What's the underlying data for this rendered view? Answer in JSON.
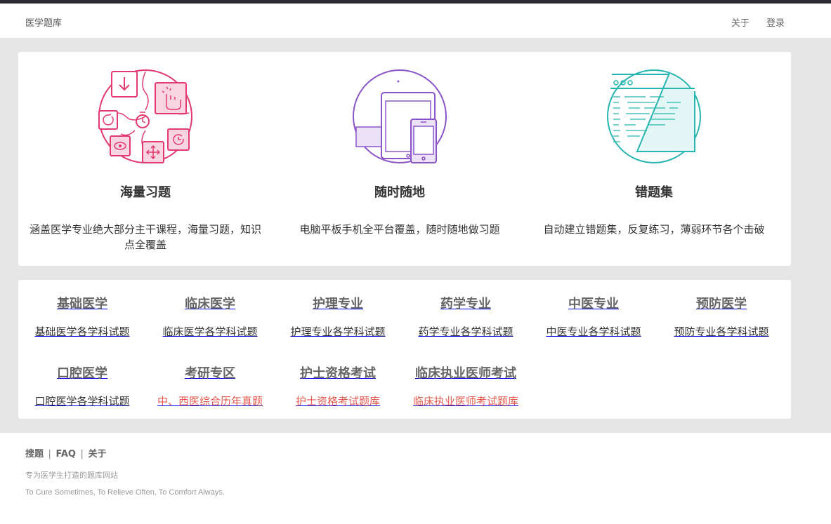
{
  "nav": {
    "brand": "医学题库",
    "links": [
      "关于",
      "登录"
    ]
  },
  "features": [
    {
      "icon": "practice-tools-icon",
      "title": "海量习题",
      "desc": "涵盖医学专业绝大部分主干课程，海量习题，知识点全覆盖"
    },
    {
      "icon": "devices-icon",
      "title": "随时随地",
      "desc": "电脑平板手机全平台覆盖，随时随地做习题"
    },
    {
      "icon": "notebook-icon",
      "title": "错题集",
      "desc": "自动建立错题集，反复练习，薄弱环节各个击破"
    }
  ],
  "subjects": [
    {
      "title": "基础医学",
      "desc": "基础医学各学科试题"
    },
    {
      "title": "临床医学",
      "desc": "临床医学各学科试题"
    },
    {
      "title": "护理专业",
      "desc": "护理专业各学科试题"
    },
    {
      "title": "药学专业",
      "desc": "药学专业各学科试题"
    },
    {
      "title": "中医专业",
      "desc": "中医专业各学科试题"
    },
    {
      "title": "预防医学",
      "desc": "预防专业各学科试题"
    },
    {
      "title": "口腔医学",
      "desc": "口腔医学各学科试题"
    },
    {
      "title": "考研专区",
      "desc": "中、西医综合历年真题"
    },
    {
      "title": "护士资格考试",
      "desc": "护士资格考试题库"
    },
    {
      "title": "临床执业医师考试",
      "desc": "临床执业医师考试题库"
    }
  ],
  "footer": {
    "links": [
      "搜题",
      "FAQ",
      "关于"
    ],
    "separator": "|",
    "tagline": "专为医学生打造的题库网站",
    "motto": "To Cure Sometimes, To Relieve Often, To Comfort Always."
  },
  "colors": {
    "pink": "#e23a6e",
    "purple": "#8a55c8",
    "teal": "#26b5b0",
    "link_red": "#e55a4e"
  }
}
